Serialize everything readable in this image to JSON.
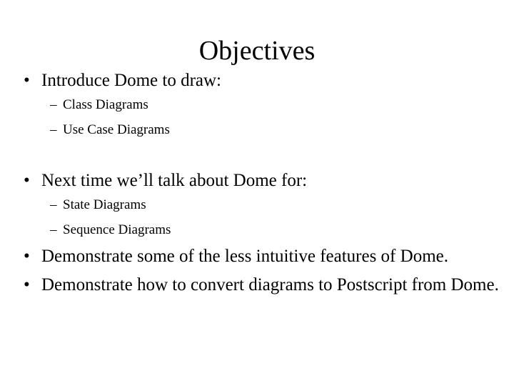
{
  "slide": {
    "title": "Objectives",
    "background_color": "#ffffff",
    "text_color": "#000000",
    "bullet_glyph": "•",
    "sub_bullet_glyph": "–",
    "groups": [
      {
        "bullet": "Introduce Dome to draw:",
        "sub_bullets": [
          "Class Diagrams",
          "Use Case Diagrams"
        ]
      },
      {
        "bullet": "Next time we’ll talk about Dome for:",
        "sub_bullets": [
          "State Diagrams",
          "Sequence Diagrams"
        ]
      }
    ],
    "closing_bullets": [
      "Demonstrate some of the less intuitive features of Dome.",
      "Demonstrate how to convert diagrams to Postscript from Dome."
    ]
  }
}
